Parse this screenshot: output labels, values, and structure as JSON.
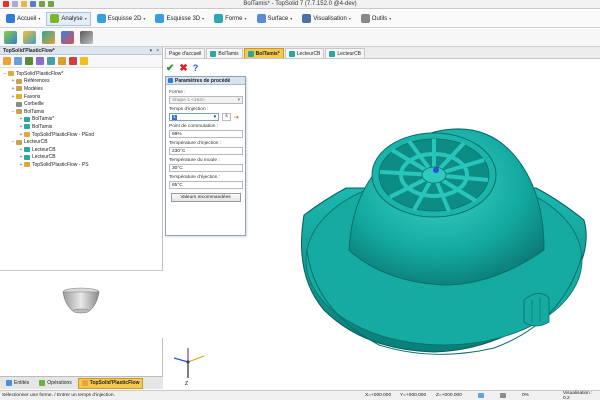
{
  "window": {
    "title": "BolTamis* - TopSolid 7 (7.7.152.0 @4-dev)"
  },
  "menu": [
    {
      "label": "Accueil",
      "color": "#2f7bd1"
    },
    {
      "label": "Analyse",
      "color": "#7ab828",
      "active": true
    },
    {
      "label": "Esquisse 2D",
      "color": "#3a9fe0"
    },
    {
      "label": "Esquisse 3D",
      "color": "#3a9fe0"
    },
    {
      "label": "Forme",
      "color": "#2fa7b0"
    },
    {
      "label": "Surface",
      "color": "#5d8ad8"
    },
    {
      "label": "Visualisation",
      "color": "#4d6fa8"
    },
    {
      "label": "Outils",
      "color": "#888888"
    }
  ],
  "panel": {
    "title": "TopSolid'PlasticFlow*",
    "tree": [
      {
        "label": "TopSolid'PlasticFlow*",
        "level": 0,
        "exp": "−",
        "color": "#e8a33b"
      },
      {
        "label": "Références",
        "level": 1,
        "exp": "+",
        "color": "#c8a050"
      },
      {
        "label": "Modèles",
        "level": 1,
        "exp": "+",
        "color": "#c8a050"
      },
      {
        "label": "Favoris",
        "level": 1,
        "exp": "+",
        "color": "#e0b030"
      },
      {
        "label": "Corbeille",
        "level": 1,
        "exp": "",
        "color": "#8a8a8a"
      },
      {
        "label": "BolTamis",
        "level": 1,
        "exp": "−",
        "color": "#c8a050"
      },
      {
        "label": "BolTamis*",
        "level": 2,
        "exp": "+",
        "color": "#2aa8a0"
      },
      {
        "label": "BolTamis",
        "level": 2,
        "exp": "+",
        "color": "#2aa8a0"
      },
      {
        "label": "TopSolid'PlasticFlow - PEnd",
        "level": 2,
        "exp": "+",
        "color": "#e8a33b"
      },
      {
        "label": "LecteurCB",
        "level": 1,
        "exp": "−",
        "color": "#c8a050"
      },
      {
        "label": "LecteurCB",
        "level": 2,
        "exp": "+",
        "color": "#2aa8a0"
      },
      {
        "label": "LecteurCB",
        "level": 2,
        "exp": "+",
        "color": "#2aa8a0"
      },
      {
        "label": "TopSolid'PlasticFlow - PS",
        "level": 2,
        "exp": "+",
        "color": "#e8a33b"
      }
    ]
  },
  "bottom_tabs": [
    {
      "label": "Entités",
      "color": "#4a8fd8"
    },
    {
      "label": "Opérations",
      "color": "#6ab04a"
    },
    {
      "label": "TopSolid'PlasticFlow",
      "color": "#e8a33b",
      "active": true
    }
  ],
  "doc_tabs": [
    {
      "label": "Page d'accueil",
      "color": ""
    },
    {
      "label": "BolTamis",
      "color": "#2aa8a0"
    },
    {
      "label": "BolTamis*",
      "color": "#2aa8a0",
      "active": true
    },
    {
      "label": "LecteurCB",
      "color": "#2aa8a0"
    },
    {
      "label": "LecteurCB",
      "color": "#2aa8a0"
    }
  ],
  "actions": {
    "ok": "✔",
    "cancel": "✖",
    "help": "?"
  },
  "dialog": {
    "title": "Paramètres de procédé",
    "forme_label": "Forme :",
    "forme_value": "Shape 1 <163>",
    "injection_time_label": "Temps d'injection :",
    "injection_time_value": "1",
    "injection_time_unit": "s",
    "commutation_label": "Point de commutation :",
    "commutation_value": "99%",
    "inj_temp_label": "Température d'injection :",
    "inj_temp_value": "230°C",
    "mold_temp_label": "Température du moule :",
    "mold_temp_value": "30°C",
    "eject_temp_label": "Température d'éjection :",
    "eject_temp_value": "85°C",
    "recommended_button": "Valeurs recommandées"
  },
  "status": {
    "message": "Sélectionner une forme. / Entrer un temps d'injection.",
    "x": "X=+000.000",
    "y": "Y=+000.000",
    "z": "Z=+000.000",
    "percent": "0%",
    "visual": "Visualisation : 0.2"
  },
  "colors": {
    "model_teal": "#12a8a0",
    "accent_orange": "#f5c94e"
  }
}
